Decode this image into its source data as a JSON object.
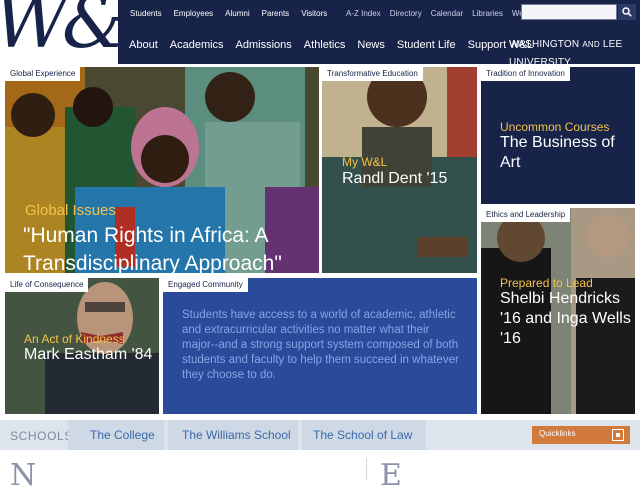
{
  "header": {
    "logo_text": "W&",
    "util_left": [
      "Students",
      "Employees",
      "Alumni",
      "Parents",
      "Visitors"
    ],
    "util_right": [
      "A-Z Index",
      "Directory",
      "Calendar",
      "Libraries",
      "Webmail"
    ],
    "search_placeholder": "",
    "nav": [
      "About",
      "Academics",
      "Admissions",
      "Athletics",
      "News",
      "Student Life",
      "Support W&L"
    ],
    "brand_main": "WASHINGTON",
    "brand_and": "AND",
    "brand_rest": "LEE UNIVERSITY"
  },
  "tiles": {
    "global": {
      "label": "Global Experience",
      "kicker": "Global Issues",
      "headline": "\"Human Rights in Africa: A Transdisciplinary Approach\""
    },
    "transform": {
      "label": "Transformative Education",
      "kicker": "My W&L",
      "headline": "Randl Dent '15"
    },
    "tradition": {
      "label": "Tradition of Innovation",
      "kicker": "Uncommon Courses",
      "headline": "The Business of Art"
    },
    "ethics": {
      "label": "Ethics and Leadership",
      "kicker": "Prepared to Lead",
      "headline": "Shelbi Hendricks '16 and Inga Wells '16"
    },
    "consequence": {
      "label": "Life of Consequence",
      "kicker": "An Act of Kindness",
      "headline": "Mark Eastham '84"
    },
    "community": {
      "label": "Engaged Community",
      "body": "Students have access to a world of academic, athletic and extracurricular activities no matter what their major--and a strong support system composed of both students and faculty to help them succeed in whatever they choose to do."
    }
  },
  "schools": {
    "label": "SCHOOLS",
    "items": [
      "The College",
      "The Williams School",
      "The School of Law"
    ],
    "quicklinks": "Quicklinks"
  },
  "below": {
    "left_letter": "N",
    "right_letter": "E"
  },
  "colors": {
    "navy": "#172348",
    "gold": "#f3c34a",
    "blue": "#2b4b9a",
    "orange": "#d17a3b"
  }
}
